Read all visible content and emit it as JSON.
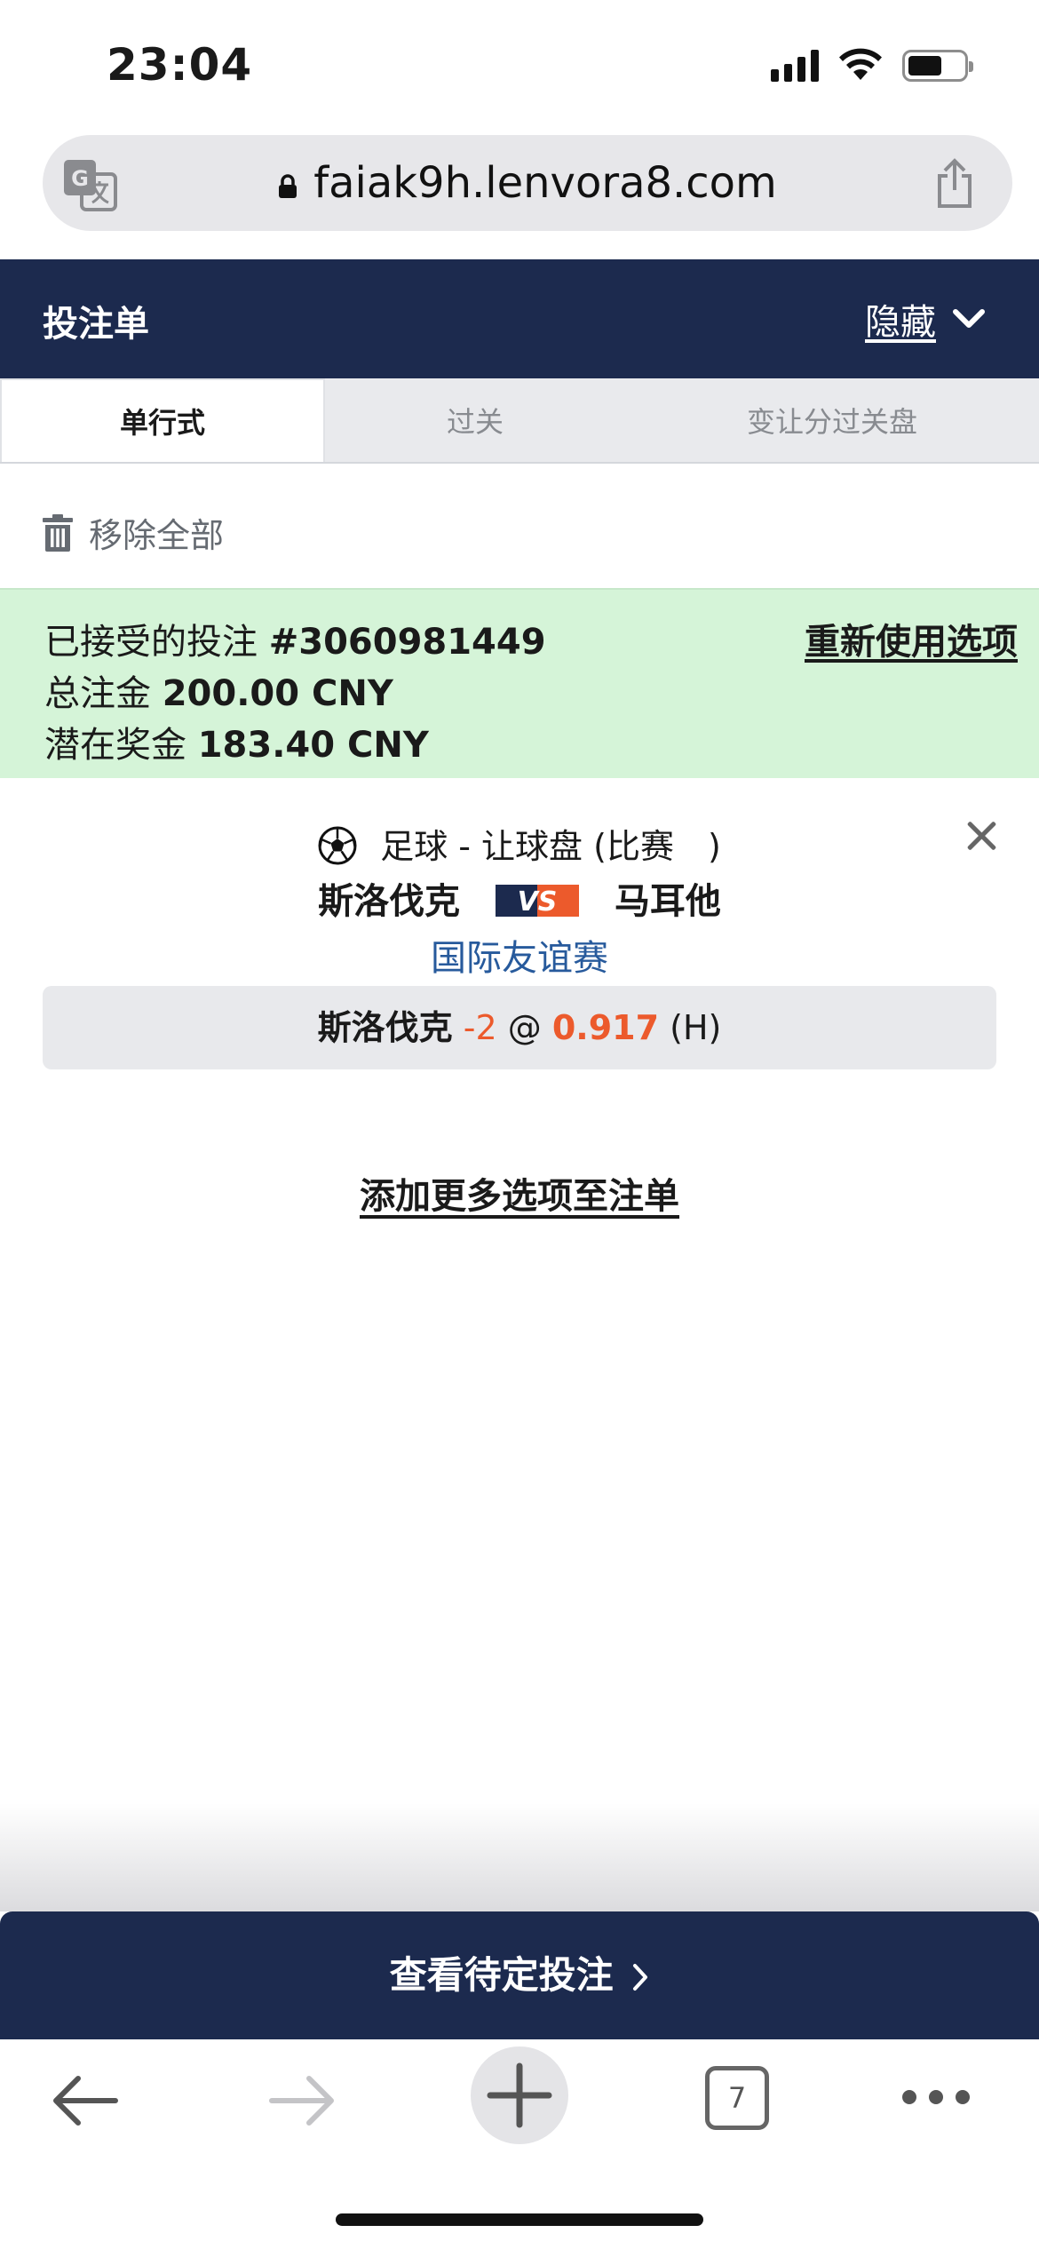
{
  "status_bar": {
    "time": "23:04"
  },
  "browser": {
    "url": "faiak9h.lenvora8.com",
    "tab_count": "7"
  },
  "betslip": {
    "title": "投注单",
    "hide_label": "隐藏",
    "tabs": [
      {
        "label": "单行式",
        "active": true
      },
      {
        "label": "过关",
        "active": false
      },
      {
        "label": "变让分过关盘",
        "active": false
      }
    ],
    "remove_all": "移除全部"
  },
  "accepted": {
    "label": "已接受的投注",
    "bet_id": "#3060981449",
    "reuse_label": "重新使用选项",
    "stake_label": "总注金",
    "stake_value": "200.00 CNY",
    "win_label": "潜在奖金",
    "win_value": "183.40 CNY"
  },
  "bet": {
    "market": "足球 - 让球盘 (比赛　)",
    "home_team": "斯洛伐克",
    "vs_text": "VS",
    "away_team": "马耳他",
    "league": "国际友谊赛",
    "selection_team": "斯洛伐克",
    "handicap": "-2",
    "at": "@",
    "odds": "0.917",
    "side": "(H)"
  },
  "add_more": "添加更多选项至注单",
  "pending": "查看待定投注",
  "colors": {
    "navy": "#1c2a4e",
    "accepted_bg": "#d5f4d8",
    "accent_orange": "#ec5a2c",
    "league_blue": "#275a9c"
  }
}
